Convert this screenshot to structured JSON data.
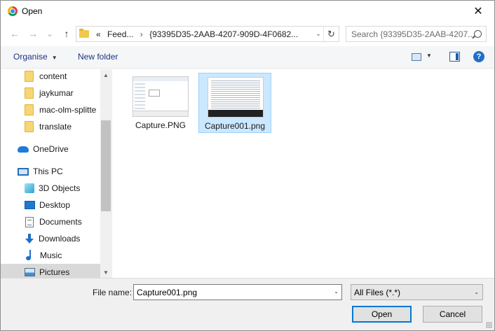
{
  "window": {
    "title": "Open",
    "close_glyph": "✕"
  },
  "nav": {
    "back_glyph": "←",
    "forward_glyph": "→",
    "recent_glyph": "⌄",
    "up_glyph": "↑",
    "address": {
      "overflow": "«",
      "crumb1": "Feed...",
      "sep": "›",
      "crumb2": "{93395D35-2AAB-4207-909D-4F0682...",
      "dropdown_glyph": "⌄",
      "refresh_glyph": "↻"
    },
    "search": {
      "placeholder": "Search {93395D35-2AAB-4207..."
    }
  },
  "toolbar": {
    "organise": "Organise",
    "new_folder": "New folder",
    "caret": "▼",
    "help": "?"
  },
  "sidebar": {
    "items": [
      {
        "label": "content",
        "icon": "folder-icon"
      },
      {
        "label": "jaykumar",
        "icon": "folder-icon"
      },
      {
        "label": "mac-olm-splitte",
        "icon": "folder-icon"
      },
      {
        "label": "translate",
        "icon": "folder-icon"
      },
      {
        "label": "OneDrive",
        "icon": "onedrive-icon"
      },
      {
        "label": "This PC",
        "icon": "pc-icon"
      },
      {
        "label": "3D Objects",
        "icon": "3d-objects-icon"
      },
      {
        "label": "Desktop",
        "icon": "desktop-icon"
      },
      {
        "label": "Documents",
        "icon": "documents-icon"
      },
      {
        "label": "Downloads",
        "icon": "downloads-icon"
      },
      {
        "label": "Music",
        "icon": "music-icon"
      },
      {
        "label": "Pictures",
        "icon": "pictures-icon",
        "selected": true
      }
    ],
    "scroll_up": "▲",
    "scroll_down": "▼"
  },
  "files": [
    {
      "name": "Capture.PNG",
      "selected": false
    },
    {
      "name": "Capture001.png",
      "selected": true
    }
  ],
  "footer": {
    "file_name_label": "File name:",
    "file_name_value": "Capture001.png",
    "file_type": "All Files (*.*)",
    "open_label": "Open",
    "cancel_label": "Cancel",
    "caret": "⌄"
  },
  "colors": {
    "accent": "#0078d7",
    "selection": "#cce8ff",
    "link": "#1e3287"
  }
}
